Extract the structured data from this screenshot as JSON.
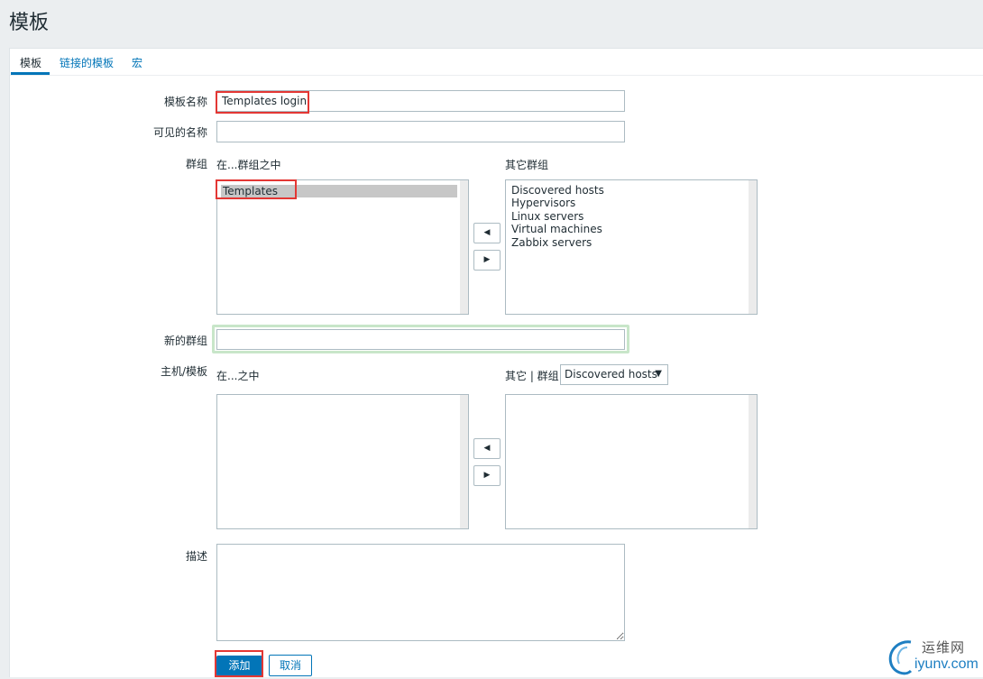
{
  "page": {
    "title": "模板"
  },
  "tabs": [
    {
      "label": "模板"
    },
    {
      "label": "链接的模板"
    },
    {
      "label": "宏"
    }
  ],
  "form": {
    "template_name_label": "模板名称",
    "template_name_value": "Templates login",
    "visible_name_label": "可见的名称",
    "visible_name_value": "",
    "groups_label": "群组",
    "in_groups_label": "在...群组之中",
    "other_groups_label": "其它群组",
    "in_groups": [
      "Templates"
    ],
    "other_groups": [
      "Discovered hosts",
      "Hypervisors",
      "Linux servers",
      "Virtual machines",
      "Zabbix servers"
    ],
    "new_group_label": "新的群组",
    "new_group_value": "",
    "hosts_label": "主机/模板",
    "in_hosts_label": "在...之中",
    "other_hosts_label": "其它 | 群组",
    "group_select_value": "Discovered hosts",
    "description_label": "描述",
    "description_value": "",
    "add_button": "添加",
    "cancel_button": "取消"
  },
  "arrows": {
    "left": "◀",
    "right": "▶"
  },
  "watermark": {
    "text_cn": "运维网",
    "text_en": "iyunv.com"
  },
  "colors": {
    "accent": "#0275b8",
    "highlight": "#e33734",
    "focus": "#c8e6c9"
  }
}
